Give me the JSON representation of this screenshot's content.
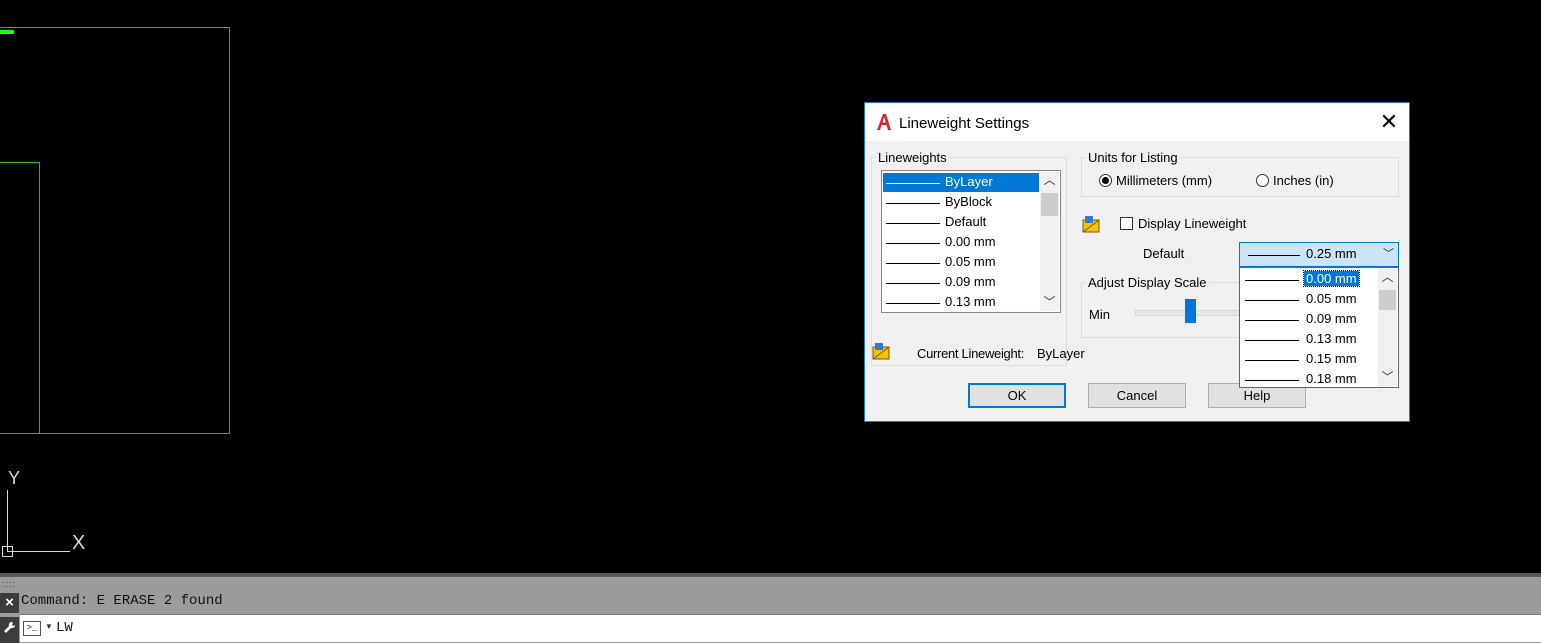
{
  "canvas": {
    "ucs": {
      "y_label": "Y",
      "x_label": "X"
    }
  },
  "command_line": {
    "grip": "::::",
    "close_glyph": "×",
    "history": "Command: E ERASE 2 found",
    "prompt_icon": ">_",
    "input": "LW"
  },
  "dialog": {
    "title": "Lineweight Settings",
    "close_glyph": "✕",
    "lineweights": {
      "legend": "Lineweights",
      "items": [
        "ByLayer",
        "ByBlock",
        "Default",
        "0.00 mm",
        "0.05 mm",
        "0.09 mm",
        "0.13 mm"
      ],
      "selected": "ByLayer"
    },
    "units": {
      "legend": "Units for Listing",
      "mm_label": "Millimeters (mm)",
      "in_label": "Inches (in)",
      "selected": "Millimeters (mm)"
    },
    "display_lineweight": {
      "label": "Display Lineweight",
      "checked": false
    },
    "default": {
      "label": "Default",
      "value": "0.25 mm",
      "options": [
        "0.00 mm",
        "0.05 mm",
        "0.09 mm",
        "0.13 mm",
        "0.15 mm",
        "0.18 mm"
      ],
      "highlighted": "0.00 mm"
    },
    "display_scale": {
      "legend": "Adjust Display Scale",
      "min_label": "Min"
    },
    "current": {
      "label": "Current Lineweight:",
      "value": "ByLayer"
    },
    "buttons": {
      "ok": "OK",
      "cancel": "Cancel",
      "help": "Help"
    }
  }
}
